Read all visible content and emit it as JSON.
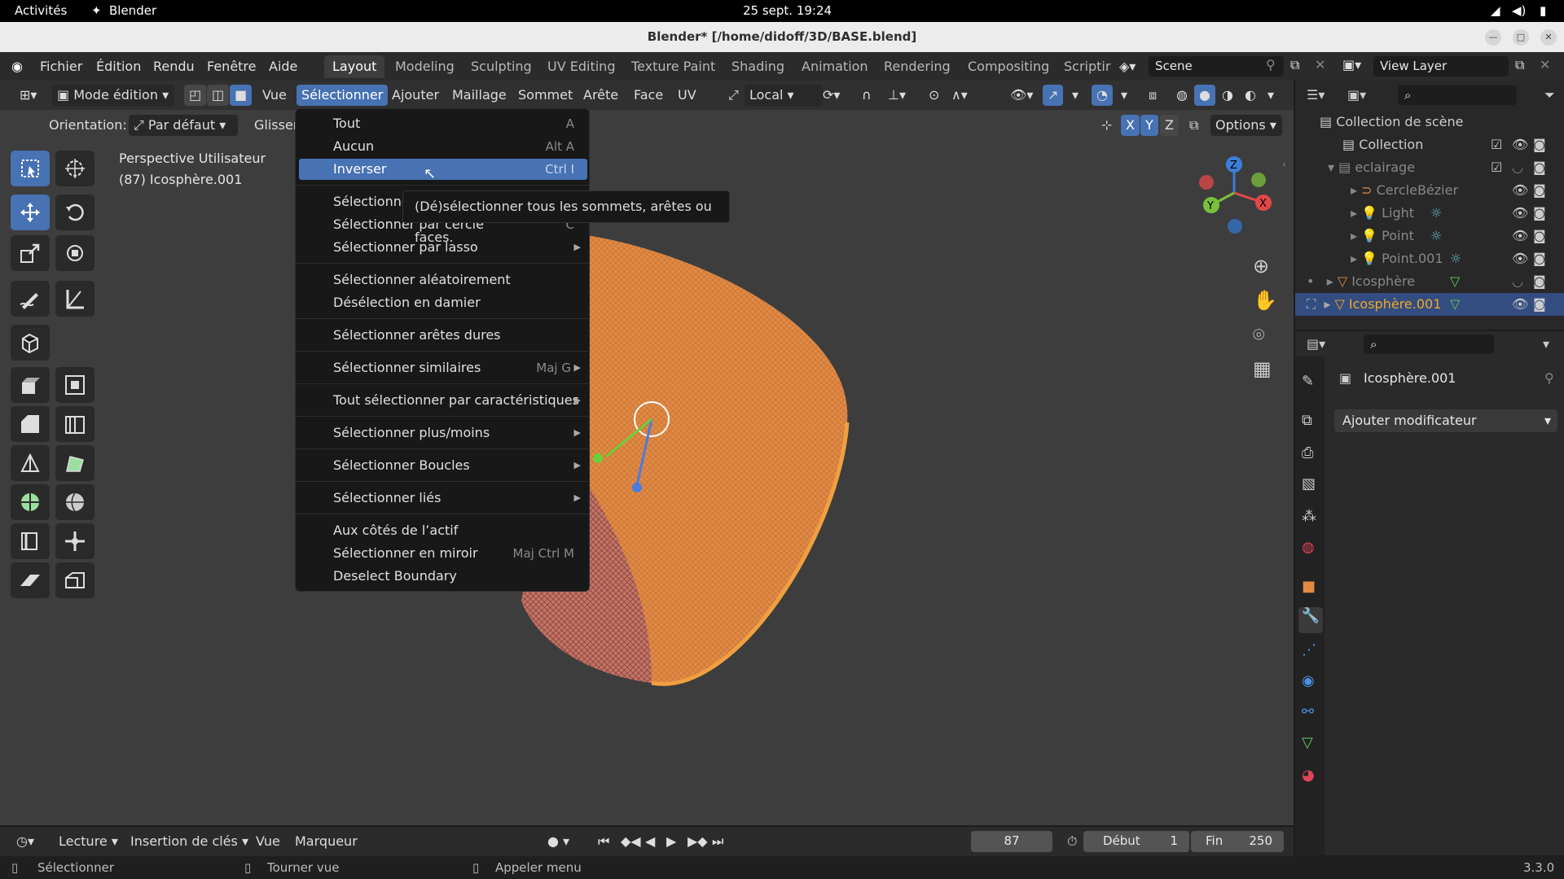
{
  "gnome": {
    "activities": "Activités",
    "app": "Blender",
    "clock": "25 sept.  19:24"
  },
  "window": {
    "title": "Blender* [/home/didoff/3D/BASE.blend]"
  },
  "topmenu": [
    "Fichier",
    "Édition",
    "Rendu",
    "Fenêtre",
    "Aide"
  ],
  "workspaces": [
    "Layout",
    "Modeling",
    "Sculpting",
    "UV Editing",
    "Texture Paint",
    "Shading",
    "Animation",
    "Rendering",
    "Compositing",
    "Scriptir"
  ],
  "scene": {
    "name": "Scene",
    "view_layer": "View Layer"
  },
  "header": {
    "mode": "Mode édition",
    "menus": [
      "Vue",
      "Sélectionner",
      "Ajouter",
      "Maillage",
      "Sommet",
      "Arête",
      "Face",
      "UV"
    ],
    "transform_orientation": "Local",
    "orientation_label": "Orientation:",
    "orientation_value": "Par défaut",
    "drag_label": "Glisser",
    "axes": [
      "X",
      "Y",
      "Z"
    ],
    "options": "Options"
  },
  "viewport": {
    "view_name": "Perspective Utilisateur",
    "object_info": "(87) Icosphère.001"
  },
  "select_menu": {
    "items": [
      {
        "label": "Tout",
        "shortcut": "A"
      },
      {
        "label": "Aucun",
        "shortcut": "Alt A"
      },
      {
        "label": "Inverser",
        "shortcut": "Ctrl I"
      },
      {
        "label": "Sélectionner"
      },
      {
        "label": "Sélectionner par cercle",
        "shortcut": "C"
      },
      {
        "label": "Sélectionner par lasso"
      },
      {
        "label": "Sélectionner aléatoirement"
      },
      {
        "label": "Désélection en damier"
      },
      {
        "label": "Sélectionner arêtes dures"
      },
      {
        "label": "Sélectionner similaires",
        "shortcut": "Maj G"
      },
      {
        "label": "Tout sélectionner par caractéristiques"
      },
      {
        "label": "Sélectionner plus/moins"
      },
      {
        "label": "Sélectionner Boucles"
      },
      {
        "label": "Sélectionner liés"
      },
      {
        "label": "Aux côtés de l’actif"
      },
      {
        "label": "Sélectionner en miroir",
        "shortcut": "Maj Ctrl M"
      },
      {
        "label": "Deselect Boundary"
      }
    ],
    "tooltip": "(Dé)sélectionner tous les sommets, arêtes ou faces."
  },
  "outliner": {
    "root": "Collection de scène",
    "rows": [
      "Collection",
      "eclairage",
      "CercleBézier",
      "Light",
      "Point",
      "Point.001",
      "Icosphère",
      "Icosphère.001"
    ]
  },
  "properties": {
    "object_name": "Icosphère.001",
    "add_modifier": "Ajouter modificateur"
  },
  "timeline": {
    "playback": "Lecture",
    "keying": "Insertion de clés",
    "view": "Vue",
    "markers": "Marqueur",
    "current_frame": "87",
    "start_label": "Début",
    "start": "1",
    "end_label": "Fin",
    "end": "250"
  },
  "status": {
    "left": "Sélectionner",
    "middle": "Tourner vue",
    "right": "Appeler menu",
    "version": "3.3.0"
  },
  "colors": {
    "accent": "#4772b3",
    "mesh": "#e08a45",
    "active_object": "#f5a623"
  }
}
